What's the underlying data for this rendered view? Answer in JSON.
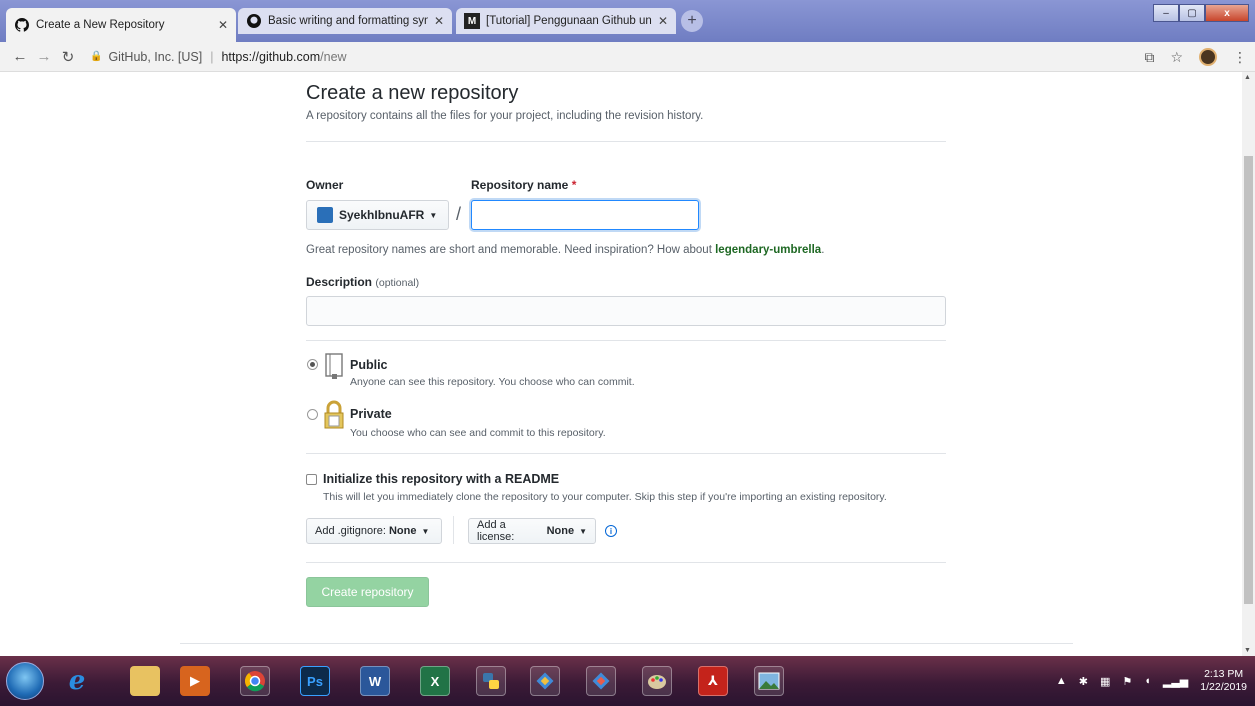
{
  "browser": {
    "tabs": [
      {
        "title": "Create a New Repository",
        "icon": "github-icon",
        "active": true
      },
      {
        "title": "Basic writing and formatting synt",
        "icon": "github-icon",
        "active": false
      },
      {
        "title": "[Tutorial] Penggunaan Github un",
        "icon": "medium-icon",
        "active": false
      }
    ],
    "new_tab": "+",
    "site_identity": "GitHub, Inc. [US]",
    "url_host": "https://github.com",
    "url_path": "/new",
    "window_controls": [
      "–",
      "▢",
      "x"
    ]
  },
  "page": {
    "title": "Create a new repository",
    "subtitle": "A repository contains all the files for your project, including the revision history.",
    "owner_label": "Owner",
    "owner_value": "SyekhIbnuAFR",
    "repo_name_label": "Repository name",
    "required_mark": "*",
    "separator": "/",
    "repo_name_value": "",
    "hint_prefix": "Great repository names are short and memorable. Need inspiration? How about ",
    "hint_suggestion": "legendary-umbrella",
    "hint_suffix": ".",
    "description_label": "Description",
    "description_optional": "(optional)",
    "description_value": "",
    "visibility": [
      {
        "title": "Public",
        "note": "Anyone can see this repository. You choose who can commit.",
        "selected": true
      },
      {
        "title": "Private",
        "note": "You choose who can see and commit to this repository.",
        "selected": false
      }
    ],
    "readme_label": "Initialize this repository with a README",
    "readme_note": "This will let you immediately clone the repository to your computer. Skip this step if you're importing an existing repository.",
    "readme_checked": false,
    "gitignore_label": "Add .gitignore:",
    "gitignore_value": "None",
    "license_label": "Add a license:",
    "license_value": "None",
    "info_glyph": "i",
    "create_button": "Create repository"
  },
  "taskbar": {
    "apps": [
      "start-orb",
      "ie-icon",
      "file-explorer-icon",
      "media-icon",
      "chrome-icon",
      "photoshop-icon",
      "word-icon",
      "excel-icon",
      "python-icon",
      "git-icon",
      "git-icon",
      "paint-icon",
      "acrobat-icon",
      "photo-viewer-icon"
    ],
    "ps_label": "Ps",
    "word_label": "W",
    "excel_label": "X",
    "time": "2:13 PM",
    "date": "1/22/2019"
  }
}
